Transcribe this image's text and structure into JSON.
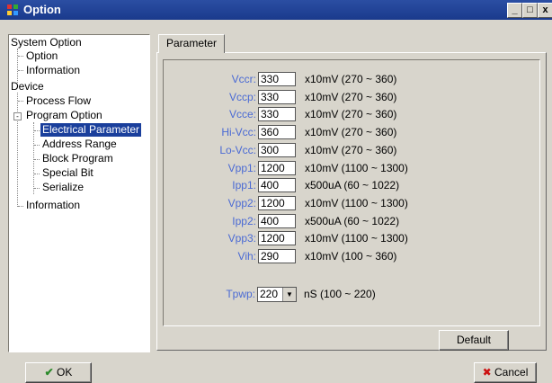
{
  "window": {
    "title": "Option",
    "minimize": "_",
    "maximize": "□",
    "close": "x"
  },
  "tree": {
    "nodes": [
      {
        "label": "System Option"
      },
      {
        "label": "Option"
      },
      {
        "label": "Information"
      },
      {
        "label": "Device"
      },
      {
        "label": "Process Flow"
      },
      {
        "label": "Program Option"
      },
      {
        "label": "Electrical Parameter"
      },
      {
        "label": "Address Range"
      },
      {
        "label": "Block Program"
      },
      {
        "label": "Special Bit"
      },
      {
        "label": "Serialize"
      },
      {
        "label": "Information"
      }
    ],
    "expander": "-"
  },
  "tab": {
    "label": "Parameter"
  },
  "params": [
    {
      "label": "Vccr:",
      "value": "330",
      "unit": "x10mV  (270 ~ 360)"
    },
    {
      "label": "Vccp:",
      "value": "330",
      "unit": "x10mV  (270 ~ 360)"
    },
    {
      "label": "Vcce:",
      "value": "330",
      "unit": "x10mV  (270 ~ 360)"
    },
    {
      "label": "Hi-Vcc:",
      "value": "360",
      "unit": "x10mV  (270 ~ 360)"
    },
    {
      "label": "Lo-Vcc:",
      "value": "300",
      "unit": "x10mV  (270 ~ 360)"
    },
    {
      "label": "Vpp1:",
      "value": "1200",
      "unit": "x10mV  (1100 ~ 1300)"
    },
    {
      "label": "Ipp1:",
      "value": "400",
      "unit": "x500uA  (60 ~ 1022)"
    },
    {
      "label": "Vpp2:",
      "value": "1200",
      "unit": "x10mV  (1100 ~ 1300)"
    },
    {
      "label": "Ipp2:",
      "value": "400",
      "unit": "x500uA  (60 ~ 1022)"
    },
    {
      "label": "Vpp3:",
      "value": "1200",
      "unit": "x10mV  (1100 ~ 1300)"
    },
    {
      "label": "Vih:",
      "value": "290",
      "unit": "x10mV  (100 ~ 360)"
    }
  ],
  "tpwp": {
    "label": "Tpwp:",
    "value": "220",
    "arrow": "▼",
    "unit": "nS  (100 ~ 220)"
  },
  "buttons": {
    "default": "Default",
    "ok": "OK",
    "ok_icon": "✔",
    "cancel": "Cancel",
    "cancel_icon": "✖"
  },
  "colors": {
    "titlebar": "#1a3a8c",
    "selected": "#1a3f9c",
    "label": "#4a6ad4",
    "ok_check": "#2a8a2a",
    "cancel_x": "#cc1111"
  }
}
